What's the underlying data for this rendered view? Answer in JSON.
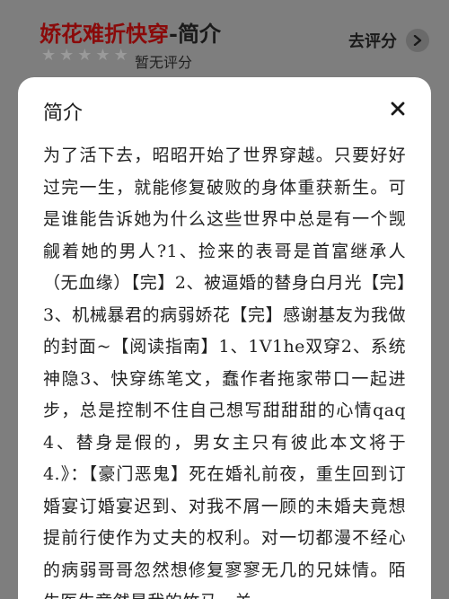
{
  "header": {
    "title_main": "娇花难折快穿",
    "title_suffix": "-简介",
    "rating_text": "暂无评分",
    "rate_label": "去评分",
    "star_count": 5,
    "star_filled": 0
  },
  "sheet": {
    "title": "简介",
    "close_glyph": "✕",
    "body": "为了活下去，昭昭开始了世界穿越。只要好好过完一生，就能修复破败的身体重获新生。可是谁能告诉她为什么这些世界中总是有一个觊觎着她的男人?1、捡来的表哥是首富继承人（无血缘）【完】2、被逼婚的替身白月光【完】3、机械暴君的病弱娇花【完】感谢基友为我做的封面~【阅读指南】1、1V1he双穿2、系统神隐3、快穿练笔文，蠢作者拖家带口一起进步，总是控制不住自己想写甜甜甜的心情qaq4、替身是假的，男女主只有彼此本文将于4.》：【豪门恶鬼】死在婚礼前夜，重生回到订婚宴订婚宴迟到、对我不屑一顾的未婚夫竟想提前行使作为丈夫的权利。对一切都漫不经心的病弱哥哥忽然想修复寥寥无几的兄妹情。陌生医生竟然是我的竹马，关"
  },
  "colors": {
    "title_red": "#8a0a0a",
    "overlay_gray": "#7e7e7e",
    "sheet_bg": "#ffffff"
  }
}
